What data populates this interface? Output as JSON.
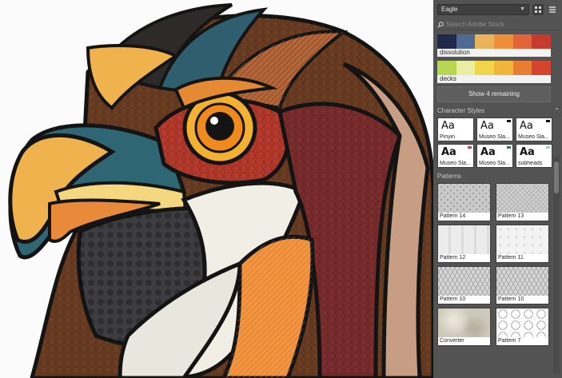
{
  "library": {
    "selected": "Eagle",
    "search_placeholder": "Search Adobe Stock"
  },
  "color_themes": [
    {
      "name": "dissolution",
      "colors": [
        "#1f2a4a",
        "#4d6a94",
        "#e9b35c",
        "#ee8f3c",
        "#e2653a",
        "#c73b2f"
      ]
    },
    {
      "name": "decks",
      "colors": [
        "#b9d653",
        "#e9eea0",
        "#f1d64b",
        "#f0b53a",
        "#e77e31",
        "#d4442f"
      ]
    }
  ],
  "show_remaining_label": "Show 4 remaining",
  "character_styles": {
    "title": "Character Styles",
    "items": [
      {
        "name": "Pinyin",
        "sample": "Aa",
        "bold": false,
        "flag": ""
      },
      {
        "name": "Museo Sla...",
        "sample": "Aa",
        "bold": false,
        "flag": "#111111"
      },
      {
        "name": "Museo Sla...",
        "sample": "Aa",
        "bold": false,
        "flag": "#111111"
      },
      {
        "name": "Museo Sla...",
        "sample": "Aa",
        "bold": true,
        "flag": "#d83a3a"
      },
      {
        "name": "Museo Sla...",
        "sample": "Aa",
        "bold": true,
        "flag": "#2e7d4f"
      },
      {
        "name": "subheads",
        "sample": "Aa",
        "bold": true,
        "flag": "#8ed7d2"
      }
    ]
  },
  "patterns": {
    "title": "Patterns",
    "items": [
      {
        "name": "Pattern 14",
        "style": "p-hex"
      },
      {
        "name": "Pattern 13",
        "style": "p-scales"
      },
      {
        "name": "Pattern 12",
        "style": "p-light"
      },
      {
        "name": "Pattern 11",
        "style": "p-lighter"
      },
      {
        "name": "Pattern 10",
        "style": "p-mesh"
      },
      {
        "name": "Pattern 10",
        "style": "p-mesh"
      },
      {
        "name": "Converter",
        "style": "p-stone"
      },
      {
        "name": "Pattern 7",
        "style": "p-bighex"
      }
    ]
  },
  "icons": {
    "library_dropdown": "chevron-down-icon",
    "grid_view": "grid-view-icon",
    "list_view": "list-view-icon",
    "search": "search-icon",
    "section_toggle": "chevron-up-icon"
  }
}
